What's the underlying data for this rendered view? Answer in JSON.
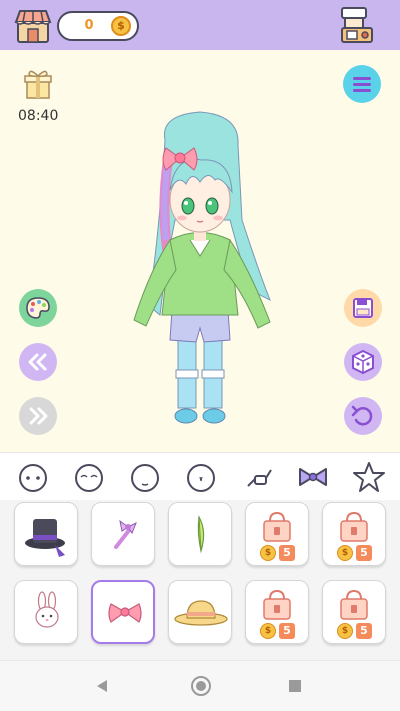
{
  "topbar": {
    "coin_count": "0",
    "coin_symbol": "$",
    "shop_icon": "shop-stall-icon",
    "machine_icon": "gacha-machine-icon",
    "colors": {
      "background": "#c9b6ee",
      "coin_text": "#f0932b"
    }
  },
  "stage": {
    "timer": "08:40",
    "background": "#fffbe9",
    "buttons": {
      "menu": "menu-icon",
      "palette": "palette-icon",
      "back": "double-chevron-left-icon",
      "forward": "double-chevron-right-icon",
      "save": "floppy-disk-icon",
      "random": "dice-icon",
      "undo": "undo-icon"
    }
  },
  "categories": [
    {
      "name": "face-1",
      "icon": "face-icon"
    },
    {
      "name": "face-2",
      "icon": "face-icon"
    },
    {
      "name": "face-3",
      "icon": "face-icon"
    },
    {
      "name": "face-4",
      "icon": "face-icon"
    },
    {
      "name": "accessory",
      "icon": "glasses-icon"
    },
    {
      "name": "bow",
      "icon": "bow-icon",
      "selected": true
    },
    {
      "name": "favorite",
      "icon": "star-icon"
    }
  ],
  "items": [
    {
      "name": "top-hat",
      "icon": "top-hat-icon",
      "locked": false
    },
    {
      "name": "bow-wand",
      "icon": "wand-icon",
      "locked": false
    },
    {
      "name": "feather",
      "icon": "feather-icon",
      "locked": false
    },
    {
      "name": "locked-item-1",
      "icon": "gift-lock-icon",
      "locked": true,
      "price": "5"
    },
    {
      "name": "locked-item-2",
      "icon": "gift-lock-icon",
      "locked": true,
      "price": "5"
    },
    {
      "name": "bunny-clip",
      "icon": "bunny-icon",
      "locked": false
    },
    {
      "name": "pink-bow",
      "icon": "bow-icon",
      "locked": false,
      "selected": true
    },
    {
      "name": "straw-hat",
      "icon": "hat-icon",
      "locked": false
    },
    {
      "name": "locked-item-3",
      "icon": "gift-lock-icon",
      "locked": true,
      "price": "5"
    },
    {
      "name": "locked-item-4",
      "icon": "gift-lock-icon",
      "locked": true,
      "price": "5"
    }
  ],
  "price_symbol": "$"
}
